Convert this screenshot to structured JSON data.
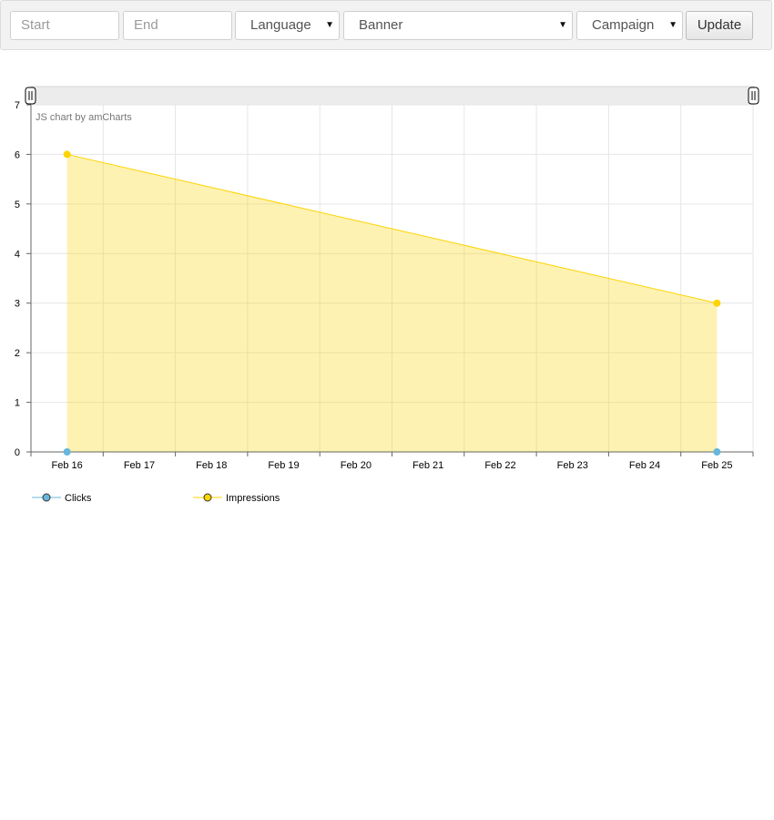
{
  "filters": {
    "start": {
      "value": "",
      "placeholder": "Start"
    },
    "end": {
      "value": "",
      "placeholder": "End"
    },
    "language": {
      "selected": "Language"
    },
    "banner": {
      "selected": "Banner"
    },
    "campaign": {
      "selected": "Campaign"
    },
    "update_label": "Update"
  },
  "chart_credit": "JS chart by amCharts",
  "chart_data": {
    "type": "area",
    "x": [
      "Feb 16",
      "Feb 17",
      "Feb 18",
      "Feb 19",
      "Feb 20",
      "Feb 21",
      "Feb 22",
      "Feb 23",
      "Feb 24",
      "Feb 25"
    ],
    "series": [
      {
        "name": "Clicks",
        "points": [
          {
            "x": "Feb 16",
            "y": 0
          },
          {
            "x": "Feb 25",
            "y": 0
          }
        ],
        "color": "#67b7dc"
      },
      {
        "name": "Impressions",
        "points": [
          {
            "x": "Feb 16",
            "y": 6
          },
          {
            "x": "Feb 25",
            "y": 3
          }
        ],
        "color": "#fdd400"
      }
    ],
    "yticks": [
      0,
      1,
      2,
      3,
      4,
      5,
      6,
      7
    ],
    "ylim": [
      0,
      7
    ],
    "grid": true,
    "legend": "bottom-left",
    "scrollbar": true
  }
}
